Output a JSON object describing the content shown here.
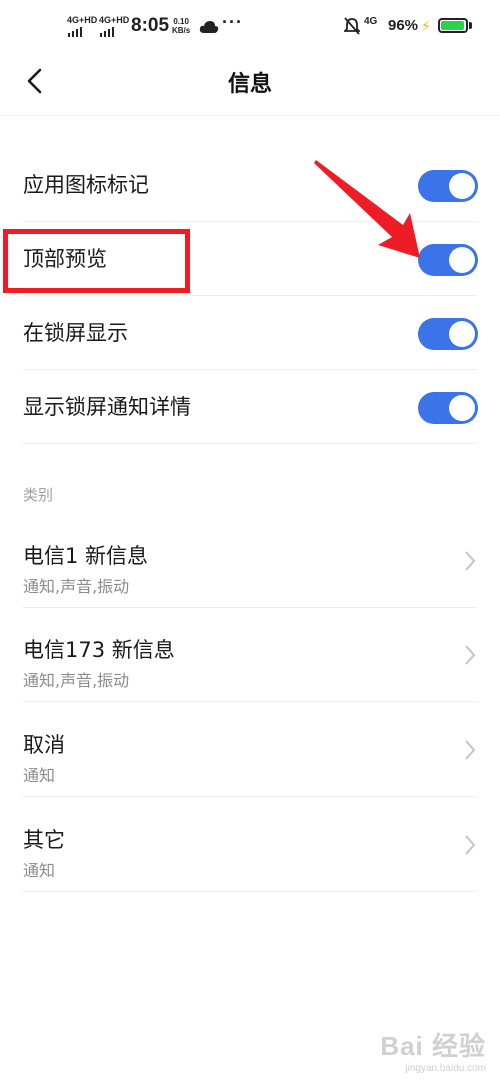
{
  "status_bar": {
    "net1": "4G+HD",
    "net2": "4G+HD",
    "time": "8:05",
    "speed_value": "0.10",
    "speed_unit": "KB/s",
    "overflow": "···",
    "mobile": "4G",
    "battery_pct": "96%",
    "battery_level": 0.96,
    "battery_color": "#2dd24b",
    "icons": [
      "signal-icon",
      "cloud-icon",
      "mute-bell-icon",
      "charging-bolt-icon",
      "battery-icon"
    ]
  },
  "header": {
    "title": "信息",
    "back_icon": "back-chevron-icon"
  },
  "settings": [
    {
      "label": "应用图标标记",
      "enabled": true
    },
    {
      "label": "顶部预览",
      "enabled": true
    },
    {
      "label": "在锁屏显示",
      "enabled": true
    },
    {
      "label": "显示锁屏通知详情",
      "enabled": true
    }
  ],
  "category_header": "类别",
  "categories": [
    {
      "title": "电信1 新信息",
      "subtitle": "通知,声音,振动"
    },
    {
      "title": "电信173 新信息",
      "subtitle": "通知,声音,振动"
    },
    {
      "title": "取消",
      "subtitle": "通知"
    },
    {
      "title": "其它",
      "subtitle": "通知"
    }
  ],
  "colors": {
    "toggle_on": "#3b73e8",
    "highlight": "#ee1c25",
    "arrow": "#ee1c25"
  },
  "watermark": {
    "main": "Bai 经验",
    "sub": "jingyan.baidu.com"
  }
}
